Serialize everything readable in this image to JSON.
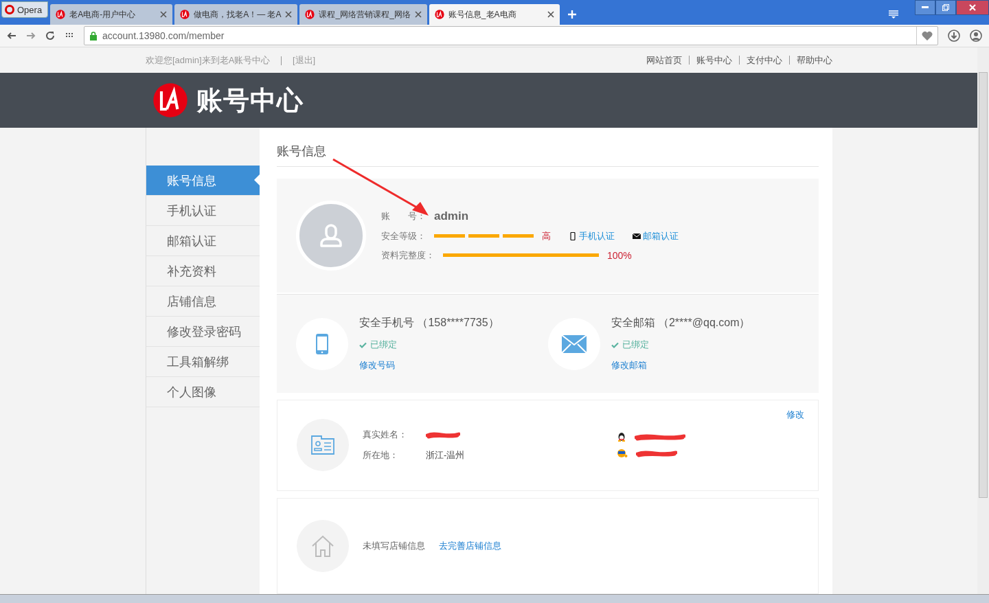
{
  "browser": {
    "menu_label": "Opera",
    "url": "account.13980.com/member",
    "tabs": [
      {
        "label": "老A电商-用户中心",
        "selected": false
      },
      {
        "label": "做电商，找老A！— 老A",
        "selected": false
      },
      {
        "label": "课程_网络营销课程_网络",
        "selected": false
      },
      {
        "label": "账号信息_老A电商",
        "selected": true
      }
    ]
  },
  "top_bar": {
    "welcome": "欢迎您[admin]来到老A账号中心",
    "logout": "[退出]",
    "links": [
      "网站首页",
      "账号中心",
      "支付中心",
      "帮助中心"
    ]
  },
  "header": {
    "title": "账号中心"
  },
  "sidebar": {
    "items": [
      {
        "label": "账号信息",
        "selected": true
      },
      {
        "label": "手机认证",
        "selected": false
      },
      {
        "label": "邮箱认证",
        "selected": false
      },
      {
        "label": "补充资料",
        "selected": false
      },
      {
        "label": "店铺信息",
        "selected": false
      },
      {
        "label": "修改登录密码",
        "selected": false
      },
      {
        "label": "工具箱解绑",
        "selected": false
      },
      {
        "label": "个人图像",
        "selected": false
      }
    ]
  },
  "main": {
    "title": "账号信息",
    "account": {
      "account_label": "账　　号：",
      "username": "admin",
      "security_label": "安全等级：",
      "security_bars": [
        {
          "filled": true
        },
        {
          "filled": true
        },
        {
          "filled": true
        }
      ],
      "security_rating": "高",
      "badges": [
        {
          "kind": "phone",
          "label": "手机认证"
        },
        {
          "kind": "email",
          "label": "邮箱认证"
        }
      ],
      "completeness_label": "资料完整度：",
      "completeness": {
        "level": 1,
        "reading": "100%"
      }
    },
    "bindings": [
      {
        "kind": "phone",
        "title": "安全手机号 （158****7735）",
        "status": "已绑定",
        "action": "修改号码"
      },
      {
        "kind": "email",
        "title": "安全邮箱 （2****@qq.com）",
        "status": "已绑定",
        "action": "修改邮箱"
      }
    ],
    "profile": {
      "edit": "修改",
      "fields": [
        {
          "label": "真实姓名：",
          "redacted": true
        },
        {
          "label": "所在地：",
          "value": "浙江-温州",
          "redacted": false
        }
      ],
      "contacts": [
        {
          "kind": "qq",
          "redacted": true
        },
        {
          "kind": "wangwang",
          "redacted": true
        }
      ]
    },
    "shop": {
      "message": "未填写店铺信息",
      "link": "去完善店铺信息"
    }
  }
}
